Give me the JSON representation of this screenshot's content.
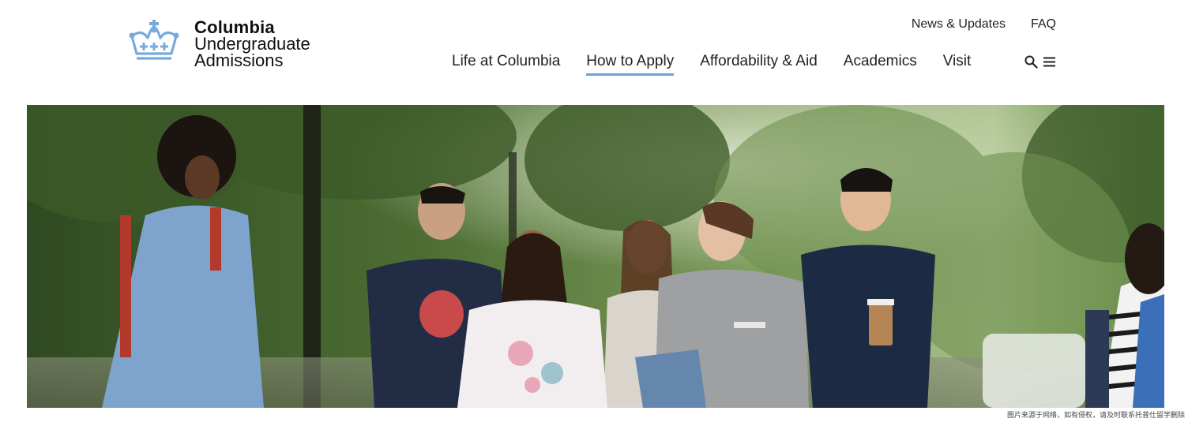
{
  "brand": {
    "name_line1": "Columbia",
    "name_line2": "Undergraduate",
    "name_line3": "Admissions",
    "color": "#75aadb"
  },
  "utility_nav": [
    {
      "label": "News & Updates"
    },
    {
      "label": "FAQ"
    }
  ],
  "main_nav": [
    {
      "label": "Life at Columbia",
      "active": false
    },
    {
      "label": "How to Apply",
      "active": true
    },
    {
      "label": "Affordability & Aid",
      "active": false
    },
    {
      "label": "Academics",
      "active": false
    },
    {
      "label": "Visit",
      "active": false
    }
  ],
  "nav_icons": [
    "search-icon",
    "menu-icon"
  ],
  "accent_color": "#6ba4d4",
  "hero": {
    "description_icon": "photo"
  },
  "watermark": "图片来源于网络，如有侵权，请及时联系托普仕留学删除"
}
